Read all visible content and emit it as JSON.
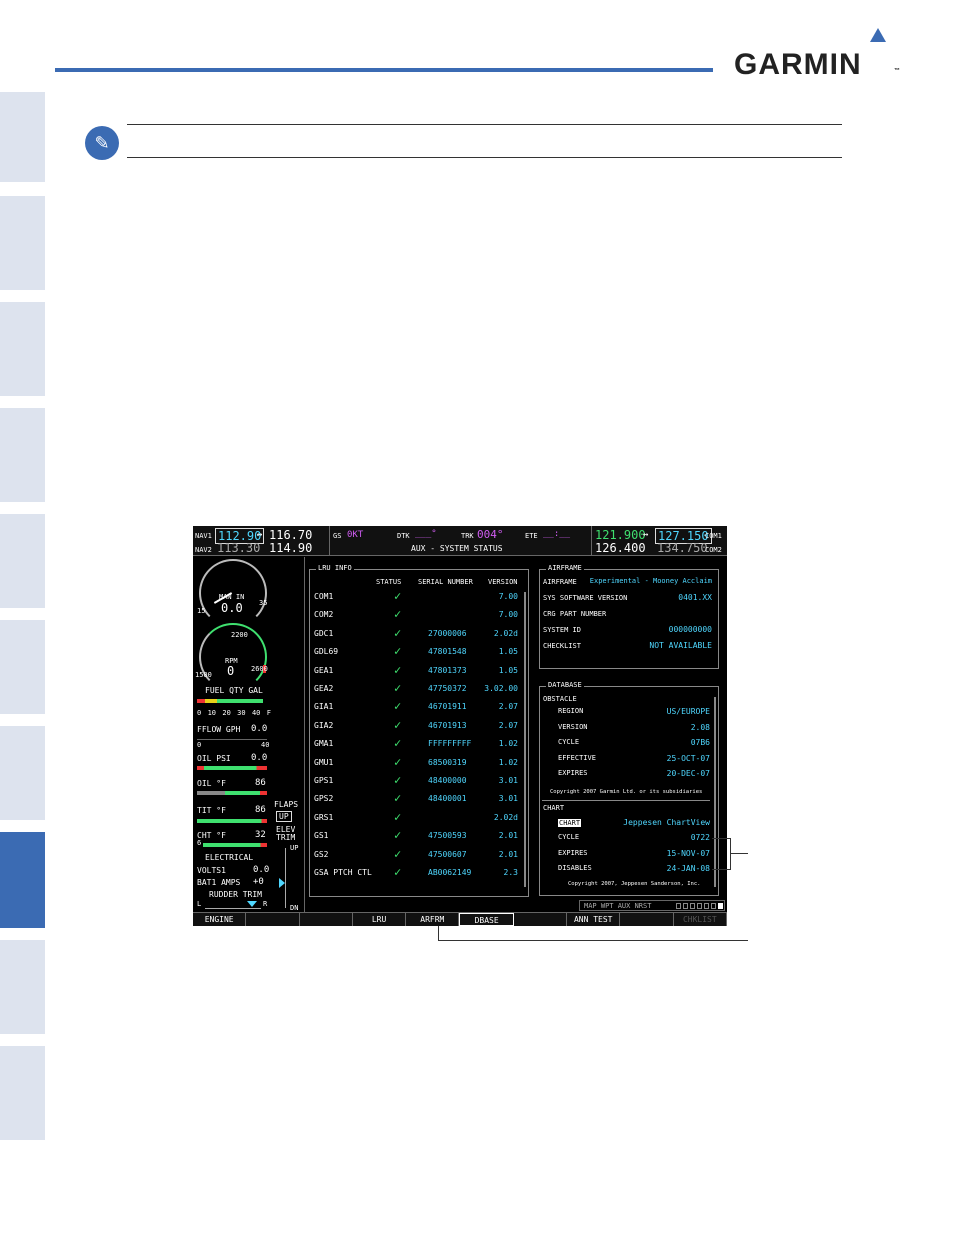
{
  "brand": {
    "name": "GARMIN",
    "tm": "™"
  },
  "screen": {
    "nav1": {
      "label": "NAV1",
      "active": "112.90",
      "arrow": "↔",
      "standby": "116.70"
    },
    "nav2": {
      "label": "NAV2",
      "active": "113.30",
      "standby": "114.90"
    },
    "gs": {
      "label": "GS",
      "value": "0KT"
    },
    "dtk": {
      "label": "DTK",
      "value": "___°"
    },
    "trk": {
      "label": "TRK",
      "value": "004°"
    },
    "ete": {
      "label": "ETE",
      "value": "__:__"
    },
    "page_title": "AUX - SYSTEM STATUS",
    "com1": {
      "label": "COM1",
      "active": "121.900",
      "arrow": "↔",
      "standby": "127.150"
    },
    "com2": {
      "label": "COM2",
      "active": "126.400",
      "standby": "134.750"
    },
    "eis": {
      "man_in": {
        "label": "MAN IN",
        "value": "0.0",
        "min": "15",
        "max": "35"
      },
      "rpm": {
        "label": "RPM",
        "value": "0",
        "tick": "2200",
        "min": "1500",
        "max": "2600"
      },
      "fuel_qty": {
        "label": "FUEL QTY GAL",
        "ticks": [
          "0",
          "10",
          "20",
          "30",
          "40",
          "F"
        ]
      },
      "fflow": {
        "label": "FFLOW GPH",
        "value": "0.0",
        "min": "0",
        "max": "40"
      },
      "oil_psi": {
        "label": "OIL PSI",
        "value": "0.0"
      },
      "oil_f": {
        "label": "OIL °F",
        "value": "86"
      },
      "tit_f": {
        "label": "TIT °F",
        "value": "86"
      },
      "cht_f": {
        "label": "CHT °F",
        "value": "32",
        "marker": "6"
      },
      "electrical": {
        "label": "ELECTRICAL",
        "volts_label": "VOLTS1",
        "volts": "0.0",
        "amps_label": "BAT1 AMPS",
        "amps": "+0"
      },
      "flaps": {
        "label": "FLAPS",
        "value": "UP"
      },
      "elev_trim": {
        "label": "ELEV TRIM",
        "up": "UP",
        "dn": "DN"
      },
      "rudder_trim": {
        "label": "RUDDER TRIM",
        "l": "L",
        "r": "R"
      }
    },
    "lru": {
      "title": "LRU INFO",
      "headers": {
        "status": "STATUS",
        "serial": "SERIAL NUMBER",
        "version": "VERSION"
      },
      "rows": [
        {
          "name": "COM1",
          "serial": "",
          "version": "7.00"
        },
        {
          "name": "COM2",
          "serial": "",
          "version": "7.00"
        },
        {
          "name": "GDC1",
          "serial": "27000006",
          "version": "2.02d"
        },
        {
          "name": "GDL69",
          "serial": "47801548",
          "version": "1.05"
        },
        {
          "name": "GEA1",
          "serial": "47801373",
          "version": "1.05"
        },
        {
          "name": "GEA2",
          "serial": "47750372",
          "version": "3.02.00"
        },
        {
          "name": "GIA1",
          "serial": "46701911",
          "version": "2.07"
        },
        {
          "name": "GIA2",
          "serial": "46701913",
          "version": "2.07"
        },
        {
          "name": "GMA1",
          "serial": "FFFFFFFFF",
          "version": "1.02"
        },
        {
          "name": "GMU1",
          "serial": "68500319",
          "version": "1.02"
        },
        {
          "name": "GPS1",
          "serial": "48400000",
          "version": "3.01"
        },
        {
          "name": "GPS2",
          "serial": "48400001",
          "version": "3.01"
        },
        {
          "name": "GRS1",
          "serial": "",
          "version": "2.02d"
        },
        {
          "name": "GS1",
          "serial": "47500593",
          "version": "2.01"
        },
        {
          "name": "GS2",
          "serial": "47500607",
          "version": "2.01"
        },
        {
          "name": "GSA PTCH CTL",
          "serial": "AB0062149",
          "version": "2.3"
        }
      ],
      "check": "✓"
    },
    "airframe": {
      "title": "AIRFRAME",
      "rows": [
        {
          "label": "AIRFRAME",
          "value": "Experimental - Mooney Acclaim"
        },
        {
          "label": "SYS SOFTWARE VERSION",
          "value": "0401.XX"
        },
        {
          "label": "CRG PART NUMBER",
          "value": ""
        },
        {
          "label": "SYSTEM ID",
          "value": "000000000"
        },
        {
          "label": "CHECKLIST",
          "value": "NOT AVAILABLE"
        }
      ]
    },
    "database": {
      "title": "DATABASE",
      "obstacle": {
        "label": "OBSTACLE",
        "rows": [
          {
            "label": "REGION",
            "value": "US/EUROPE"
          },
          {
            "label": "VERSION",
            "value": "2.08"
          },
          {
            "label": "CYCLE",
            "value": "07B6"
          },
          {
            "label": "EFFECTIVE",
            "value": "25-OCT-07"
          },
          {
            "label": "EXPIRES",
            "value": "20-DEC-07"
          }
        ],
        "copyright": "Copyright 2007 Garmin Ltd. or its subsidiaries"
      },
      "chart": {
        "label": "CHART",
        "badge": "CHART",
        "provider": "Jeppesen ChartView",
        "rows": [
          {
            "label": "CYCLE",
            "value": "0722"
          },
          {
            "label": "EXPIRES",
            "value": "15-NOV-07"
          },
          {
            "label": "DISABLES",
            "value": "24-JAN-08"
          }
        ],
        "copyright": "Copyright 2007, Jeppesen Sanderson, Inc."
      }
    },
    "page_group": {
      "text": "MAP WPT AUX NRST"
    },
    "softkeys": [
      "ENGINE",
      "",
      "",
      "LRU",
      "ARFRM",
      "DBASE",
      "",
      "ANN TEST",
      "",
      "CHKLIST"
    ]
  },
  "colors": {
    "accent": "#3b6bb3",
    "cyan": "#4fd7ff",
    "green": "#3fe06f",
    "magenta": "#d05cf2"
  }
}
